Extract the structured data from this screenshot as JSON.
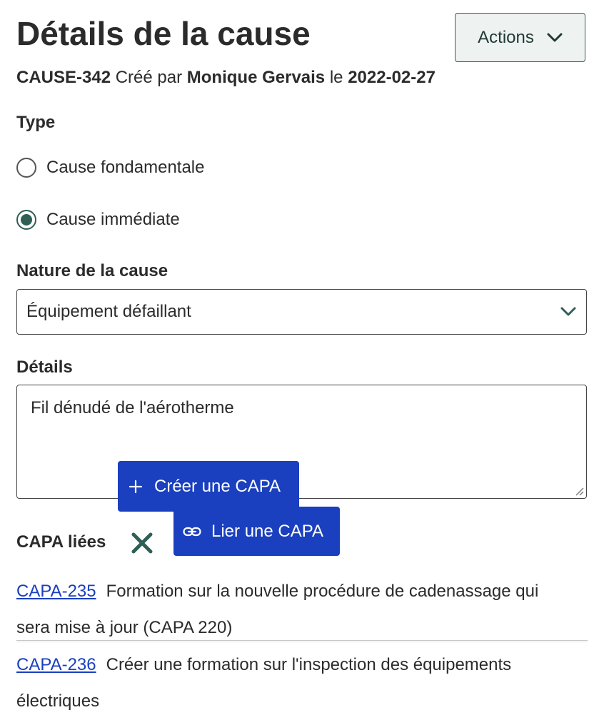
{
  "header": {
    "title": "Détails de la cause",
    "actions_label": "Actions"
  },
  "meta": {
    "id": "CAUSE-342",
    "created_by_prefix": "Créé par",
    "author": "Monique Gervais",
    "date_prefix": "le",
    "date": "2022-02-27"
  },
  "type": {
    "label": "Type",
    "options": [
      {
        "label": "Cause fondamentale",
        "checked": false
      },
      {
        "label": "Cause immédiate",
        "checked": true
      }
    ]
  },
  "nature": {
    "label": "Nature de la cause",
    "selected": "Équipement défaillant"
  },
  "details": {
    "label": "Détails",
    "value": "Fil dénudé de l'aérotherme"
  },
  "popup": {
    "create_label": "Créer une CAPA",
    "link_label": "Lier une CAPA"
  },
  "capa": {
    "label": "CAPA liées",
    "items": [
      {
        "id": "CAPA-235",
        "text_line1": "Formation sur la nouvelle procédure de cadenassage qui",
        "text_line2": "sera mise à jour (CAPA 220)"
      },
      {
        "id": "CAPA-236",
        "text_line1": "Créer une formation sur l'inspection des équipements",
        "text_line2": "électriques"
      }
    ]
  },
  "colors": {
    "accent": "#2f5f55",
    "primary_button": "#1a3fbf",
    "link": "#1a3fbf"
  }
}
